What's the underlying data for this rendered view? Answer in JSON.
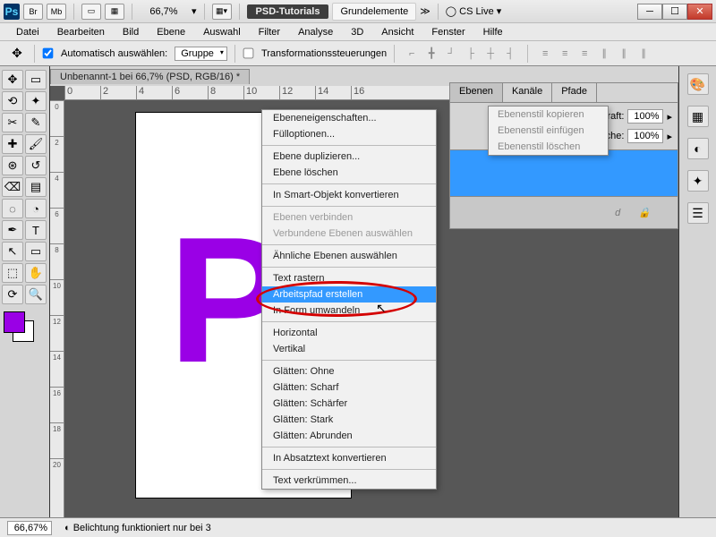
{
  "titlebar": {
    "br": "Br",
    "mb": "Mb",
    "zoom": "66,7%",
    "workspace_a": "PSD-Tutorials",
    "workspace_b": "Grundelemente",
    "cslive": "CS Live"
  },
  "menubar": [
    "Datei",
    "Bearbeiten",
    "Bild",
    "Ebene",
    "Auswahl",
    "Filter",
    "Analyse",
    "3D",
    "Ansicht",
    "Fenster",
    "Hilfe"
  ],
  "optbar": {
    "auto": "Automatisch auswählen:",
    "group": "Gruppe",
    "transform": "Transformationssteuerungen"
  },
  "doctab": "Unbenannt-1 bei 66,7% (PSD, RGB/16) *",
  "letter": "P",
  "panels": {
    "tabs": [
      "Ebenen",
      "Kanäle",
      "Pfade"
    ],
    "opacity_label": "Deckkraft:",
    "opacity": "100%",
    "fill_label": "Fläche:",
    "fill": "100%",
    "layer_text_hint": "d"
  },
  "flyout": [
    "Ebenenstil kopieren",
    "Ebenenstil einfügen",
    "Ebenenstil löschen"
  ],
  "ctxmenu": [
    {
      "t": "Ebeneneigenschaften...",
      "d": false
    },
    {
      "t": "Fülloptionen...",
      "d": false
    },
    {
      "sep": true
    },
    {
      "t": "Ebene duplizieren...",
      "d": false
    },
    {
      "t": "Ebene löschen",
      "d": false
    },
    {
      "sep": true
    },
    {
      "t": "In Smart-Objekt konvertieren",
      "d": false
    },
    {
      "sep": true
    },
    {
      "t": "Ebenen verbinden",
      "d": true
    },
    {
      "t": "Verbundene Ebenen auswählen",
      "d": true
    },
    {
      "sep": true
    },
    {
      "t": "Ähnliche Ebenen auswählen",
      "d": false
    },
    {
      "sep": true
    },
    {
      "t": "Text rastern",
      "d": false
    },
    {
      "t": "Arbeitspfad erstellen",
      "d": false,
      "hl": true
    },
    {
      "t": "In Form umwandeln",
      "d": false
    },
    {
      "sep": true
    },
    {
      "t": "Horizontal",
      "d": false
    },
    {
      "t": "Vertikal",
      "d": false
    },
    {
      "sep": true
    },
    {
      "t": "Glätten: Ohne",
      "d": false
    },
    {
      "t": "Glätten: Scharf",
      "d": false
    },
    {
      "t": "Glätten: Schärfer",
      "d": false
    },
    {
      "t": "Glätten: Stark",
      "d": false
    },
    {
      "t": "Glätten: Abrunden",
      "d": false
    },
    {
      "sep": true
    },
    {
      "t": "In Absatztext konvertieren",
      "d": false
    },
    {
      "sep": true
    },
    {
      "t": "Text verkrümmen...",
      "d": false
    }
  ],
  "status": {
    "zoom": "66,67%",
    "msg": "Belichtung funktioniert nur bei 3"
  },
  "ruler_h": [
    "0",
    "2",
    "4",
    "6",
    "8",
    "10",
    "12",
    "14",
    "16"
  ],
  "ruler_v": [
    "0",
    "2",
    "4",
    "6",
    "8",
    "10",
    "12",
    "14",
    "16",
    "18",
    "20"
  ]
}
